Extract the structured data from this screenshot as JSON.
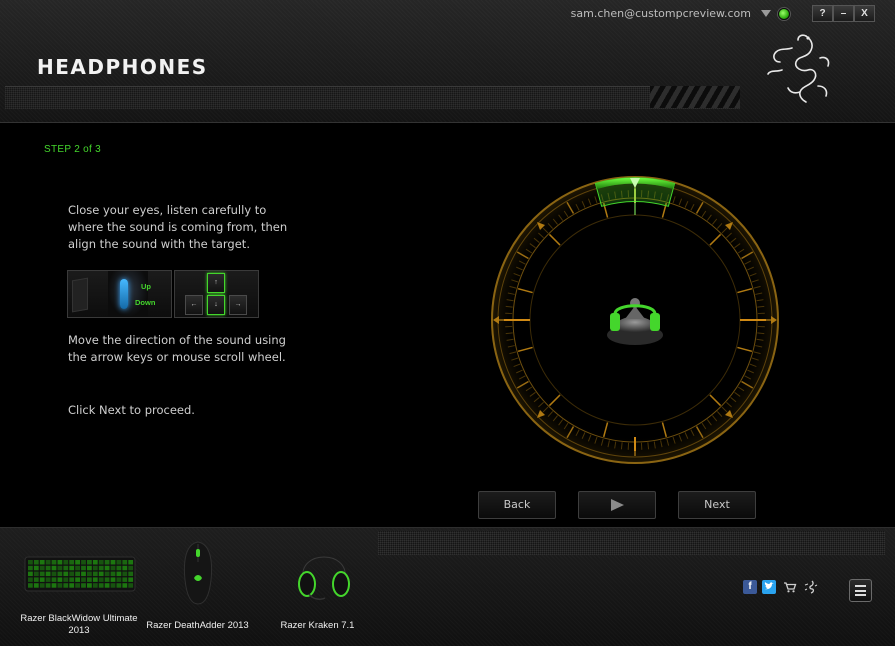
{
  "window": {
    "account_email": "sam.chen@custompcreview.com",
    "help_label": "?",
    "minimize_label": "–",
    "close_label": "X",
    "status_color": "#44d62c"
  },
  "header": {
    "title": "HEADPHONES",
    "logo_icon": "razer-snake-logo-icon"
  },
  "wizard": {
    "step": "STEP 2 of 3",
    "instruction_1": "Close your eyes, listen carefully to where the sound is coming from, then align the sound with the target.",
    "mouse_up": "Up",
    "mouse_down": "Down",
    "key_up": "↑",
    "key_left": "←",
    "key_down": "↓",
    "key_right": "→",
    "instruction_2": "Move the direction of the sound using the arrow keys or mouse scroll wheel.",
    "instruction_3": "Click Next to proceed.",
    "back_label": "Back",
    "play_icon": "play-icon",
    "next_label": "Next",
    "accent_color": "#44d62c",
    "dial_color": "#c8961a"
  },
  "devices": [
    {
      "name": "Razer BlackWidow Ultimate 2013",
      "icon": "keyboard-icon"
    },
    {
      "name": "Razer DeathAdder 2013",
      "icon": "mouse-icon"
    },
    {
      "name": "Razer Kraken 7.1",
      "icon": "headset-icon"
    }
  ],
  "footer_icons": [
    "facebook-icon",
    "twitter-icon",
    "cart-icon",
    "razer-icon",
    "menu-icon"
  ]
}
